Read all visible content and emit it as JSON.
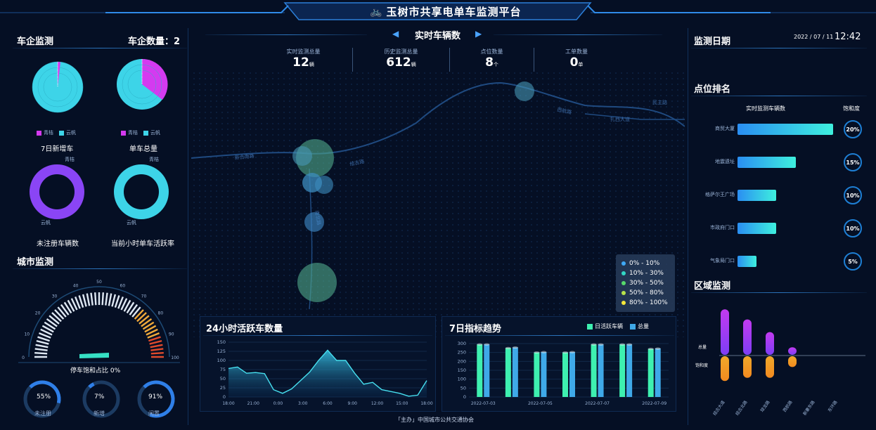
{
  "header": {
    "title": "玉树市共享电单车监测平台"
  },
  "left": {
    "companies": {
      "title": "车企监测",
      "count_label": "车企数量：2",
      "pies": [
        {
          "label": "7日新增车",
          "legend": [
            "青桔",
            "云帆"
          ]
        },
        {
          "label": "单车总量",
          "legend": [
            "青桔",
            "云帆"
          ]
        },
        {
          "label": "未注册车辆数",
          "top": "青桔",
          "bottom": "云帆"
        },
        {
          "label": "当前小时单车活跃率",
          "top": "青桔",
          "bottom": "云帆"
        }
      ]
    },
    "city": {
      "title": "城市监测",
      "gauge_ticks": [
        "0",
        "10",
        "20",
        "30",
        "40",
        "50",
        "60",
        "70",
        "80",
        "90",
        "100"
      ],
      "gauge_label": "停车饱和占比 0%",
      "rings": [
        {
          "value": "55%",
          "label": "未注册"
        },
        {
          "value": "7%",
          "label": "新增"
        },
        {
          "value": "91%",
          "label": "闲置"
        }
      ]
    }
  },
  "center": {
    "realtime_title": "实时车辆数",
    "stats": [
      {
        "label": "实时监测总量",
        "value": "12",
        "unit": "辆"
      },
      {
        "label": "历史监测总量",
        "value": "612",
        "unit": "辆"
      },
      {
        "label": "点位数量",
        "value": "8",
        "unit": "个"
      },
      {
        "label": "工单数量",
        "value": "0",
        "unit": "单"
      }
    ],
    "map_roads": [
      "胜利路",
      "南北路",
      "新合南路",
      "结古路",
      "西航路",
      "扎西大道",
      "民主路"
    ],
    "map_legend": [
      "0% - 10%",
      "10% - 30%",
      "30% - 50%",
      "50% - 80%",
      "80% - 100%"
    ],
    "map_legend_colors": [
      "#3fa9f5",
      "#33d6c4",
      "#56d96b",
      "#b7e34a",
      "#f5e83a"
    ],
    "footer": "「主办」中国城市公共交通协会"
  },
  "right": {
    "date_title": "监测日期",
    "date": "2022 / 07 / 11",
    "time": "12:42",
    "ranking_title": "点位排名",
    "ranking_col1": "实时监测车辆数",
    "ranking_col2": "饱和度",
    "ranking": [
      {
        "name": "商贸大厦",
        "value": 0.92,
        "pct": "20%"
      },
      {
        "name": "地震遗址",
        "value": 0.56,
        "pct": "15%"
      },
      {
        "name": "格萨尔王广场",
        "value": 0.37,
        "pct": "10%"
      },
      {
        "name": "市政府门口",
        "value": 0.37,
        "pct": "10%"
      },
      {
        "name": "气象局门口",
        "value": 0.18,
        "pct": "5%"
      }
    ],
    "region_title": "区域监测",
    "region_labels": [
      "总量",
      "饱和度"
    ],
    "regions": [
      "结古大道",
      "结古北路",
      "琼龙路",
      "西航路",
      "新寨东路",
      "东环路"
    ],
    "region_top": [
      0.9,
      0.7,
      0.45,
      0.15,
      0,
      0
    ],
    "region_bottom": [
      0.8,
      0.7,
      0.7,
      0.35,
      0,
      0
    ]
  },
  "chart_data": [
    {
      "type": "area",
      "title": "24小时活跃车数量",
      "x": [
        "18:00",
        "21:00",
        "0:00",
        "3:00",
        "6:00",
        "9:00",
        "12:00",
        "15:00",
        "18:00"
      ],
      "ylim": [
        0,
        150
      ],
      "yticks": [
        "0",
        "25",
        "50",
        "75",
        "100",
        "125",
        "150"
      ],
      "values": [
        78,
        82,
        65,
        67,
        64,
        20,
        10,
        22,
        45,
        68,
        100,
        128,
        100,
        100,
        65,
        35,
        40,
        20,
        15,
        10,
        2,
        5,
        45
      ]
    },
    {
      "type": "bar",
      "title": "7日指标趋势",
      "categories": [
        "2022-07-03",
        "",
        "2022-07-05",
        "",
        "2022-07-07",
        "",
        "2022-07-09"
      ],
      "ylim": [
        0,
        300
      ],
      "yticks": [
        "0",
        "50",
        "100",
        "150",
        "200",
        "250",
        "300"
      ],
      "series": [
        {
          "name": "日活跃车辆",
          "values": [
            295,
            275,
            250,
            250,
            295,
            295,
            270
          ],
          "color": "#3ef0b0"
        },
        {
          "name": "总量",
          "values": [
            295,
            278,
            252,
            252,
            295,
            295,
            272
          ],
          "color": "#3fa9e8"
        }
      ]
    }
  ]
}
